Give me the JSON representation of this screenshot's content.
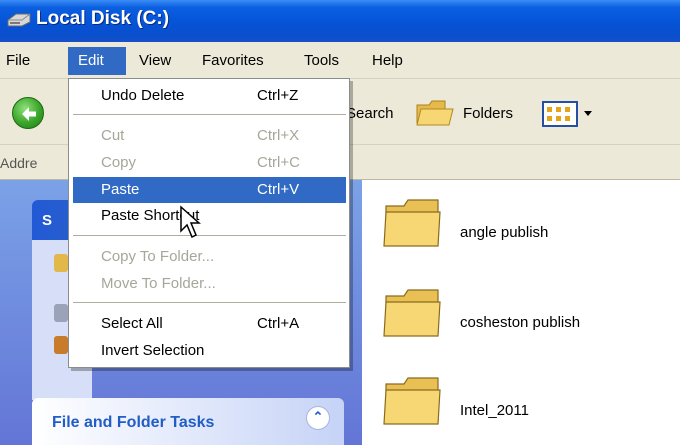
{
  "window": {
    "title": "Local Disk (C:)"
  },
  "menubar": {
    "items": [
      {
        "label": "File"
      },
      {
        "label": "Edit"
      },
      {
        "label": "View"
      },
      {
        "label": "Favorites"
      },
      {
        "label": "Tools"
      },
      {
        "label": "Help"
      }
    ]
  },
  "toolbar": {
    "search_label": "Search",
    "folders_label": "Folders"
  },
  "address": {
    "label": "Addre"
  },
  "edit_menu": {
    "items": [
      {
        "label": "Undo Delete",
        "shortcut": "Ctrl+Z",
        "enabled": true
      },
      {
        "label": "Cut",
        "shortcut": "Ctrl+X",
        "enabled": false
      },
      {
        "label": "Copy",
        "shortcut": "Ctrl+C",
        "enabled": false
      },
      {
        "label": "Paste",
        "shortcut": "Ctrl+V",
        "enabled": true,
        "highlighted": true
      },
      {
        "label": "Paste Shortcut",
        "shortcut": "",
        "enabled": true
      },
      {
        "label": "Copy To Folder...",
        "shortcut": "",
        "enabled": false
      },
      {
        "label": "Move To Folder...",
        "shortcut": "",
        "enabled": false
      },
      {
        "label": "Select All",
        "shortcut": "Ctrl+A",
        "enabled": true
      },
      {
        "label": "Invert Selection",
        "shortcut": "",
        "enabled": true
      }
    ]
  },
  "task_pane": {
    "system_tasks_label": "S",
    "file_folder_tasks_label": "File and Folder Tasks"
  },
  "folders": [
    {
      "name": "angle publish"
    },
    {
      "name": "cosheston publish"
    },
    {
      "name": "Intel_2011"
    }
  ],
  "colors": {
    "selection": "#316ac5",
    "titlebar": "#0553d6",
    "menubar": "#ece9d8",
    "taskpane": "#7ba2e7",
    "folder": "#f5d56a"
  }
}
